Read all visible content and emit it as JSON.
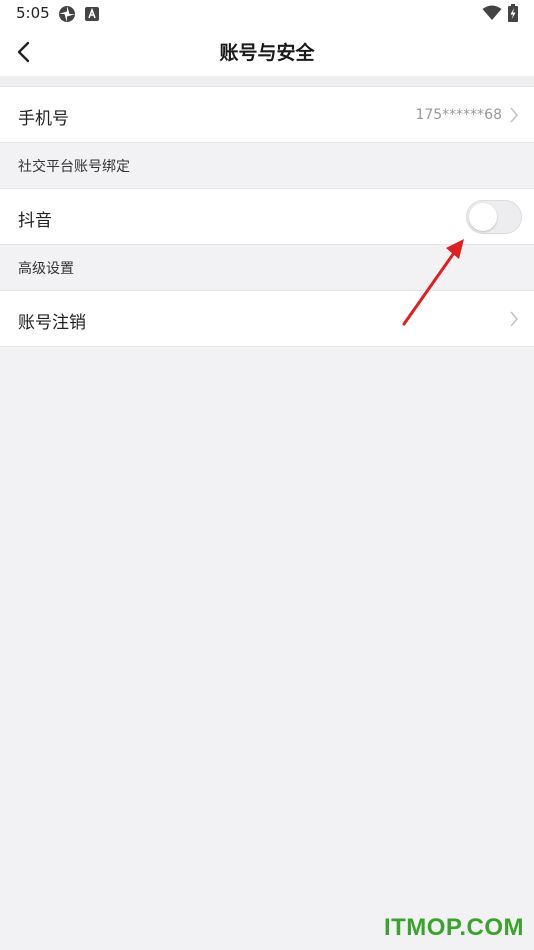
{
  "status_bar": {
    "time": "5:05",
    "icons_left": [
      "pinwheel-icon",
      "a-box-icon"
    ],
    "icons_right": [
      "wifi-icon",
      "battery-charging-icon"
    ]
  },
  "nav": {
    "back_icon": "chevron-left-icon",
    "title": "账号与安全"
  },
  "rows": {
    "phone": {
      "label": "手机号",
      "value": "175******68"
    },
    "social_header": "社交平台账号绑定",
    "douyin": {
      "label": "抖音",
      "toggle_on": false
    },
    "advanced_header": "高级设置",
    "deactivate": {
      "label": "账号注销"
    }
  },
  "annotation": {
    "arrow_color": "#e02020"
  },
  "watermark": "ITMOP.COM",
  "colors": {
    "background": "#f2f2f4",
    "row_bg": "#ffffff",
    "watermark": "#3aa32b"
  }
}
